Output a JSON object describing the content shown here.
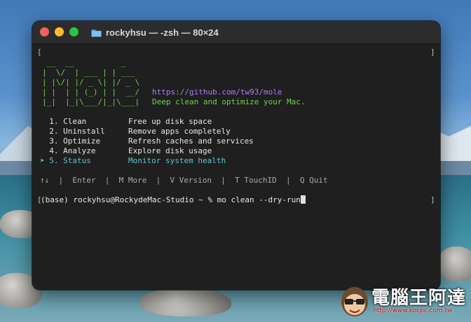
{
  "window": {
    "title": "rockyhsu — -zsh — 80×24"
  },
  "terminal": {
    "top_bracket_left": "[",
    "top_bracket_right": "]",
    "logo": [
      " __  __          _",
      "|  \\/  | ___ | | ___",
      "| |\\/| |/ _ \\| |/ _ \\",
      "| |  | | (_) | |  __/",
      "|_|  |_|\\___/|_|\\___|"
    ],
    "repo_url": "https://github.com/tw93/mole",
    "tagline": "Deep clean and optimize your Mac.",
    "menu": [
      {
        "num": "  1. Clean      ",
        "desc": "Free up disk space",
        "selected": false
      },
      {
        "num": "  2. Uninstall  ",
        "desc": "Remove apps completely",
        "selected": false
      },
      {
        "num": "  3. Optimize   ",
        "desc": "Refresh caches and services",
        "selected": false
      },
      {
        "num": "  4. Analyze    ",
        "desc": "Explore disk usage",
        "selected": false
      },
      {
        "num": "➤ 5. Status     ",
        "desc": "Monitor system health",
        "selected": true
      }
    ],
    "hints": "↑↓  |  Enter  |  M More  |  V Version  |  T TouchID  |  Q Quit",
    "prompt_bracket": "[",
    "prompt": "(base) rockyhsu@RockydeMac-Studio ~ % mo clean --dry-run",
    "prompt_bracket_right": "]"
  },
  "watermark": {
    "text": "電腦王阿達",
    "url": "http://www.kocpc.com.tw"
  },
  "colors": {
    "green": "#6fd24f",
    "purple": "#b07cf2",
    "cyan": "#5ec4d8"
  }
}
